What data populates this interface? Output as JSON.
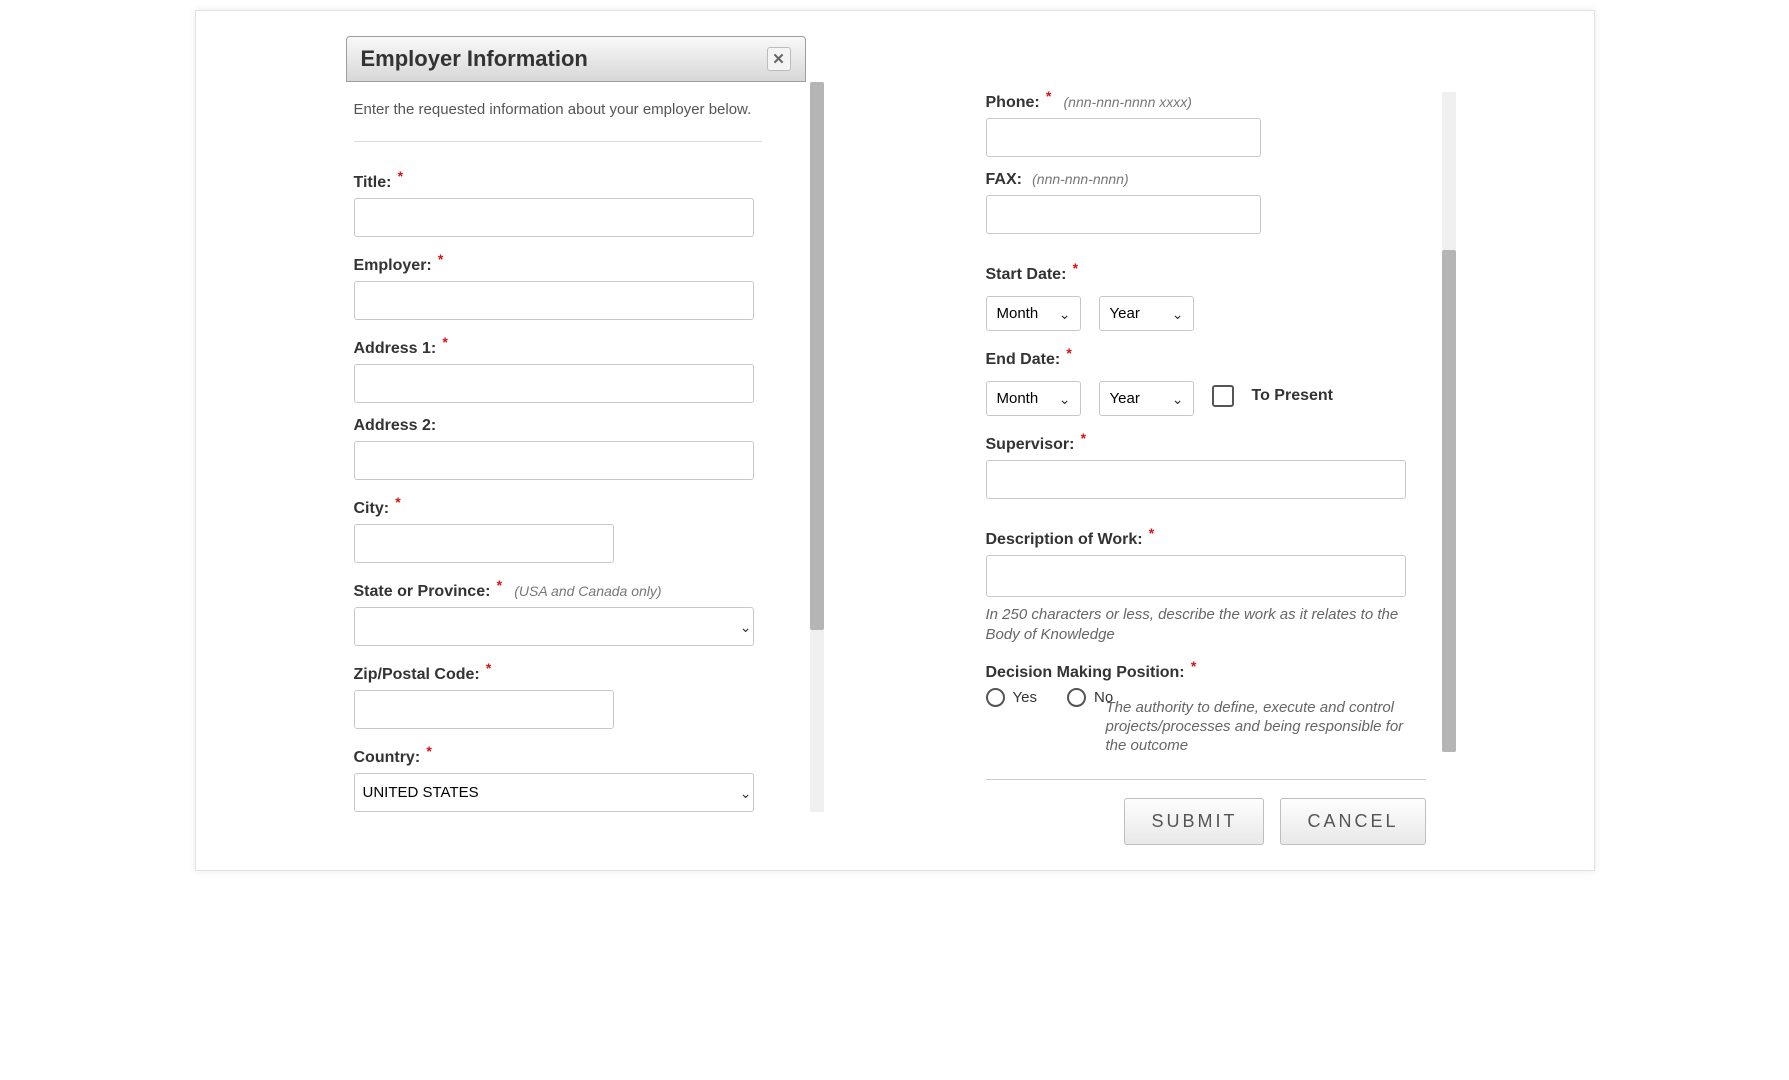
{
  "dialog": {
    "title": "Employer Information",
    "intro": "Enter the requested information about your employer below."
  },
  "left": {
    "title_label": "Title:",
    "employer_label": "Employer:",
    "address1_label": "Address 1:",
    "address2_label": "Address 2:",
    "city_label": "City:",
    "state_label": "State or Province:",
    "state_hint": "(USA and Canada only)",
    "zip_label": "Zip/Postal Code:",
    "country_label": "Country:",
    "country_value": "UNITED STATES"
  },
  "right": {
    "phone_label": "Phone:",
    "phone_hint": "(nnn-nnn-nnnn xxxx)",
    "fax_label": "FAX:",
    "fax_hint": "(nnn-nnn-nnnn)",
    "start_label": "Start Date:",
    "end_label": "End Date:",
    "month_ph": "Month",
    "year_ph": "Year",
    "present_label": "To Present",
    "supervisor_label": "Supervisor:",
    "desc_label": "Description of Work:",
    "desc_note": "In 250 characters or less, describe the work as it relates to the Body of Knowledge",
    "decision_label": "Decision Making Position:",
    "yes": "Yes",
    "no": "No",
    "decision_note": "The authority to define, execute and control projects/processes and being responsible for the outcome"
  },
  "buttons": {
    "submit": "SUBMIT",
    "cancel": "CANCEL"
  }
}
